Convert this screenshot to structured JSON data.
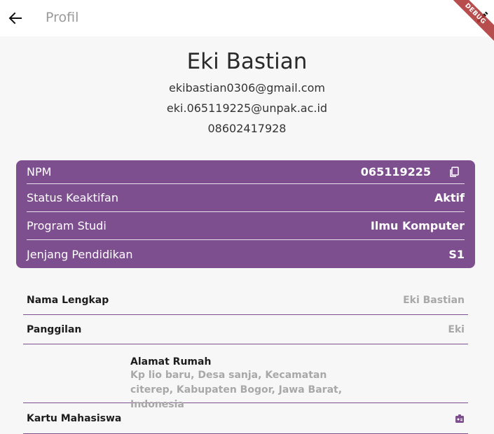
{
  "appbar": {
    "title": "Profil",
    "debug_label": "DEBUG"
  },
  "profile": {
    "name": "Eki Bastian",
    "email_personal": "ekibastian0306@gmail.com",
    "email_campus": "eki.065119225@unpak.ac.id",
    "phone": "08602417928"
  },
  "academic": {
    "npm_label": "NPM",
    "npm_value": "065119225",
    "status_label": "Status Keaktifan",
    "status_value": "Aktif",
    "program_label": "Program Studi",
    "program_value": "Ilmu Komputer",
    "level_label": "Jenjang Pendidikan",
    "level_value": "S1"
  },
  "details": {
    "fullname_label": "Nama Lengkap",
    "fullname_value": "Eki Bastian",
    "nickname_label": "Panggilan",
    "nickname_value": "Eki",
    "address_label": "Alamat Rumah",
    "address_value": "Kp lio baru, Desa sanja, Kecamatan citerep, Kabupaten Bogor, Jawa Barat, Indonesia",
    "card_label": "Kartu Mahasiswa"
  },
  "colors": {
    "accent": "#7e4f8f",
    "debug": "#b13a3a"
  },
  "icons": {
    "back": "arrow-left-icon",
    "edit": "edit-pen-icon",
    "copy": "copy-icon",
    "student_card": "id-card-icon"
  }
}
